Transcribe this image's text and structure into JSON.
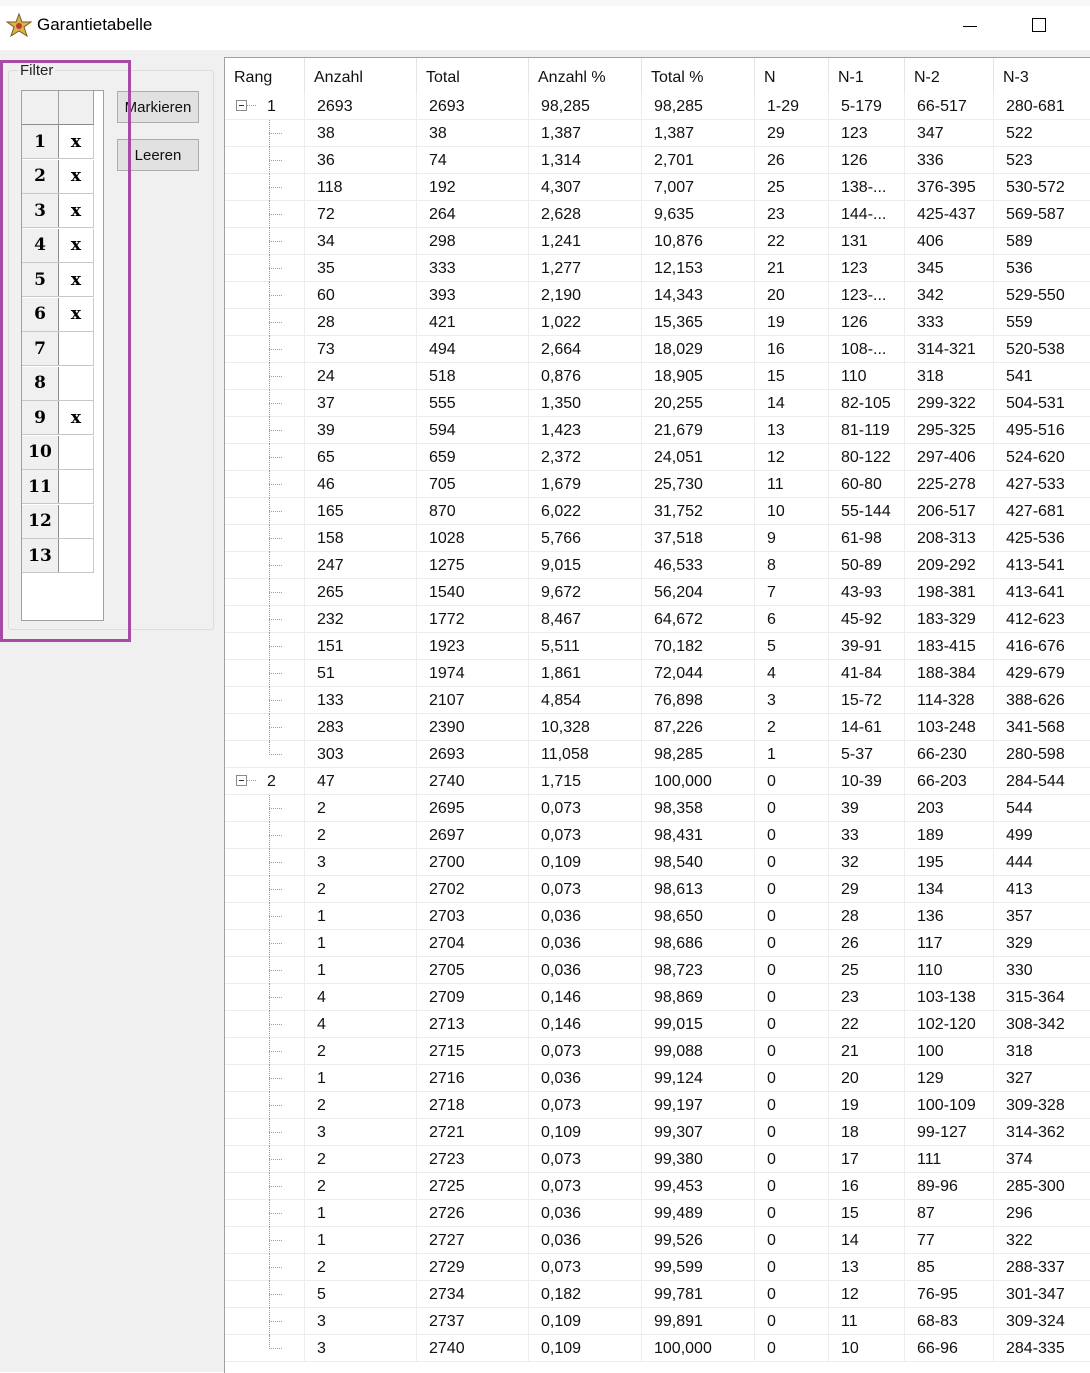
{
  "window": {
    "title": "Garantietabelle"
  },
  "filter": {
    "legend": "Filter",
    "mark_label": "Markieren",
    "clear_label": "Leeren",
    "rows": [
      {
        "num": "1",
        "val": "x"
      },
      {
        "num": "2",
        "val": "x"
      },
      {
        "num": "3",
        "val": "x"
      },
      {
        "num": "4",
        "val": "x"
      },
      {
        "num": "5",
        "val": "x"
      },
      {
        "num": "6",
        "val": "x"
      },
      {
        "num": "7",
        "val": ""
      },
      {
        "num": "8",
        "val": ""
      },
      {
        "num": "9",
        "val": "x"
      },
      {
        "num": "10",
        "val": ""
      },
      {
        "num": "11",
        "val": ""
      },
      {
        "num": "12",
        "val": ""
      },
      {
        "num": "13",
        "val": ""
      }
    ]
  },
  "table": {
    "columns": [
      "Rang",
      "Anzahl",
      "Total",
      "Anzahl %",
      "Total %",
      "N",
      "N-1",
      "N-2",
      "N-3"
    ],
    "rows": [
      {
        "group": "1",
        "cells": [
          "2693",
          "2693",
          "98,285",
          "98,285",
          "1-29",
          "5-179",
          "66-517",
          "280-681"
        ]
      },
      {
        "cells": [
          "38",
          "38",
          "1,387",
          "1,387",
          "29",
          "123",
          "347",
          "522"
        ]
      },
      {
        "cells": [
          "36",
          "74",
          "1,314",
          "2,701",
          "26",
          "126",
          "336",
          "523"
        ]
      },
      {
        "cells": [
          "118",
          "192",
          "4,307",
          "7,007",
          "25",
          "138-...",
          "376-395",
          "530-572"
        ]
      },
      {
        "cells": [
          "72",
          "264",
          "2,628",
          "9,635",
          "23",
          "144-...",
          "425-437",
          "569-587"
        ]
      },
      {
        "cells": [
          "34",
          "298",
          "1,241",
          "10,876",
          "22",
          "131",
          "406",
          "589"
        ]
      },
      {
        "cells": [
          "35",
          "333",
          "1,277",
          "12,153",
          "21",
          "123",
          "345",
          "536"
        ]
      },
      {
        "cells": [
          "60",
          "393",
          "2,190",
          "14,343",
          "20",
          "123-...",
          "342",
          "529-550"
        ]
      },
      {
        "cells": [
          "28",
          "421",
          "1,022",
          "15,365",
          "19",
          "126",
          "333",
          "559"
        ]
      },
      {
        "cells": [
          "73",
          "494",
          "2,664",
          "18,029",
          "16",
          "108-...",
          "314-321",
          "520-538"
        ]
      },
      {
        "cells": [
          "24",
          "518",
          "0,876",
          "18,905",
          "15",
          "110",
          "318",
          "541"
        ]
      },
      {
        "cells": [
          "37",
          "555",
          "1,350",
          "20,255",
          "14",
          "82-105",
          "299-322",
          "504-531"
        ]
      },
      {
        "cells": [
          "39",
          "594",
          "1,423",
          "21,679",
          "13",
          "81-119",
          "295-325",
          "495-516"
        ]
      },
      {
        "cells": [
          "65",
          "659",
          "2,372",
          "24,051",
          "12",
          "80-122",
          "297-406",
          "524-620"
        ]
      },
      {
        "cells": [
          "46",
          "705",
          "1,679",
          "25,730",
          "11",
          "60-80",
          "225-278",
          "427-533"
        ]
      },
      {
        "cells": [
          "165",
          "870",
          "6,022",
          "31,752",
          "10",
          "55-144",
          "206-517",
          "427-681"
        ]
      },
      {
        "cells": [
          "158",
          "1028",
          "5,766",
          "37,518",
          "9",
          "61-98",
          "208-313",
          "425-536"
        ]
      },
      {
        "cells": [
          "247",
          "1275",
          "9,015",
          "46,533",
          "8",
          "50-89",
          "209-292",
          "413-541"
        ]
      },
      {
        "cells": [
          "265",
          "1540",
          "9,672",
          "56,204",
          "7",
          "43-93",
          "198-381",
          "413-641"
        ]
      },
      {
        "cells": [
          "232",
          "1772",
          "8,467",
          "64,672",
          "6",
          "45-92",
          "183-329",
          "412-623"
        ]
      },
      {
        "cells": [
          "151",
          "1923",
          "5,511",
          "70,182",
          "5",
          "39-91",
          "183-415",
          "416-676"
        ]
      },
      {
        "cells": [
          "51",
          "1974",
          "1,861",
          "72,044",
          "4",
          "41-84",
          "188-384",
          "429-679"
        ]
      },
      {
        "cells": [
          "133",
          "2107",
          "4,854",
          "76,898",
          "3",
          "15-72",
          "114-328",
          "388-626"
        ]
      },
      {
        "cells": [
          "283",
          "2390",
          "10,328",
          "87,226",
          "2",
          "14-61",
          "103-248",
          "341-568"
        ]
      },
      {
        "cells": [
          "303",
          "2693",
          "11,058",
          "98,285",
          "1",
          "5-37",
          "66-230",
          "280-598"
        ]
      },
      {
        "group": "2",
        "cells": [
          "47",
          "2740",
          "1,715",
          "100,000",
          "0",
          "10-39",
          "66-203",
          "284-544"
        ]
      },
      {
        "cells": [
          "2",
          "2695",
          "0,073",
          "98,358",
          "0",
          "39",
          "203",
          "544"
        ]
      },
      {
        "cells": [
          "2",
          "2697",
          "0,073",
          "98,431",
          "0",
          "33",
          "189",
          "499"
        ]
      },
      {
        "cells": [
          "3",
          "2700",
          "0,109",
          "98,540",
          "0",
          "32",
          "195",
          "444"
        ]
      },
      {
        "cells": [
          "2",
          "2702",
          "0,073",
          "98,613",
          "0",
          "29",
          "134",
          "413"
        ]
      },
      {
        "cells": [
          "1",
          "2703",
          "0,036",
          "98,650",
          "0",
          "28",
          "136",
          "357"
        ]
      },
      {
        "cells": [
          "1",
          "2704",
          "0,036",
          "98,686",
          "0",
          "26",
          "117",
          "329"
        ]
      },
      {
        "cells": [
          "1",
          "2705",
          "0,036",
          "98,723",
          "0",
          "25",
          "110",
          "330"
        ]
      },
      {
        "cells": [
          "4",
          "2709",
          "0,146",
          "98,869",
          "0",
          "23",
          "103-138",
          "315-364"
        ]
      },
      {
        "cells": [
          "4",
          "2713",
          "0,146",
          "99,015",
          "0",
          "22",
          "102-120",
          "308-342"
        ]
      },
      {
        "cells": [
          "2",
          "2715",
          "0,073",
          "99,088",
          "0",
          "21",
          "100",
          "318"
        ]
      },
      {
        "cells": [
          "1",
          "2716",
          "0,036",
          "99,124",
          "0",
          "20",
          "129",
          "327"
        ]
      },
      {
        "cells": [
          "2",
          "2718",
          "0,073",
          "99,197",
          "0",
          "19",
          "100-109",
          "309-328"
        ]
      },
      {
        "cells": [
          "3",
          "2721",
          "0,109",
          "99,307",
          "0",
          "18",
          "99-127",
          "314-362"
        ]
      },
      {
        "cells": [
          "2",
          "2723",
          "0,073",
          "99,380",
          "0",
          "17",
          "111",
          "374"
        ]
      },
      {
        "cells": [
          "2",
          "2725",
          "0,073",
          "99,453",
          "0",
          "16",
          "89-96",
          "285-300"
        ]
      },
      {
        "cells": [
          "1",
          "2726",
          "0,036",
          "99,489",
          "0",
          "15",
          "87",
          "296"
        ]
      },
      {
        "cells": [
          "1",
          "2727",
          "0,036",
          "99,526",
          "0",
          "14",
          "77",
          "322"
        ]
      },
      {
        "cells": [
          "2",
          "2729",
          "0,073",
          "99,599",
          "0",
          "13",
          "85",
          "288-337"
        ]
      },
      {
        "cells": [
          "5",
          "2734",
          "0,182",
          "99,781",
          "0",
          "12",
          "76-95",
          "301-347"
        ]
      },
      {
        "cells": [
          "3",
          "2737",
          "0,109",
          "99,891",
          "0",
          "11",
          "68-83",
          "309-324"
        ]
      },
      {
        "cells": [
          "3",
          "2740",
          "0,109",
          "100,000",
          "0",
          "10",
          "66-96",
          "284-335"
        ]
      }
    ]
  }
}
